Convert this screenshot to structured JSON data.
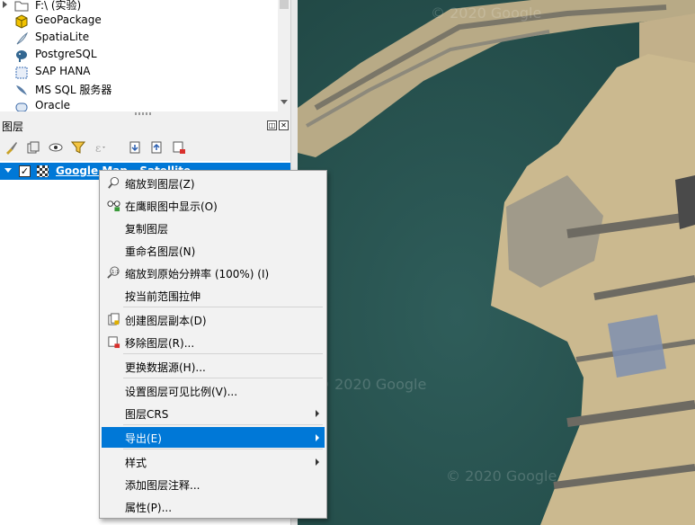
{
  "browser": {
    "items": [
      {
        "label": "F:\\ (实验)",
        "icon": "folder-icon"
      },
      {
        "label": "GeoPackage",
        "icon": "geopackage-icon"
      },
      {
        "label": "SpatiaLite",
        "icon": "spatialite-feather-icon"
      },
      {
        "label": "PostgreSQL",
        "icon": "postgresql-elephant-icon"
      },
      {
        "label": "SAP HANA",
        "icon": "sap-hana-icon"
      },
      {
        "label": "MS SQL 服务器",
        "icon": "mssql-icon"
      },
      {
        "label": "Oracle",
        "icon": "oracle-icon"
      }
    ]
  },
  "layers_panel": {
    "title": "图层",
    "dock_float": "◫",
    "dock_close": "✕",
    "layer": {
      "name": "Google Map - Satellite",
      "checked": "✓"
    }
  },
  "context_menu": {
    "items": [
      {
        "label": "缩放到图层(Z)"
      },
      {
        "label": "在鹰眼图中显示(O)"
      },
      {
        "label": "复制图层"
      },
      {
        "label": "重命名图层(N)"
      },
      {
        "label": "缩放到原始分辨率 (100%) (I)"
      },
      {
        "label": "按当前范围拉伸"
      },
      {
        "label": "创建图层副本(D)"
      },
      {
        "label": "移除图层(R)..."
      },
      {
        "label": "更换数据源(H)..."
      },
      {
        "label": "设置图层可见比例(V)..."
      },
      {
        "label": "图层CRS"
      },
      {
        "label": "导出(E)"
      },
      {
        "label": "样式"
      },
      {
        "label": "添加图层注释..."
      },
      {
        "label": "属性(P)..."
      }
    ]
  },
  "map": {
    "watermarks": [
      "© 2020 Google",
      "© 2020 Google",
      "© 2020 Google"
    ]
  },
  "colors": {
    "accent": "#0078d7",
    "water": "#2a5552",
    "land": "#c9b48a"
  }
}
